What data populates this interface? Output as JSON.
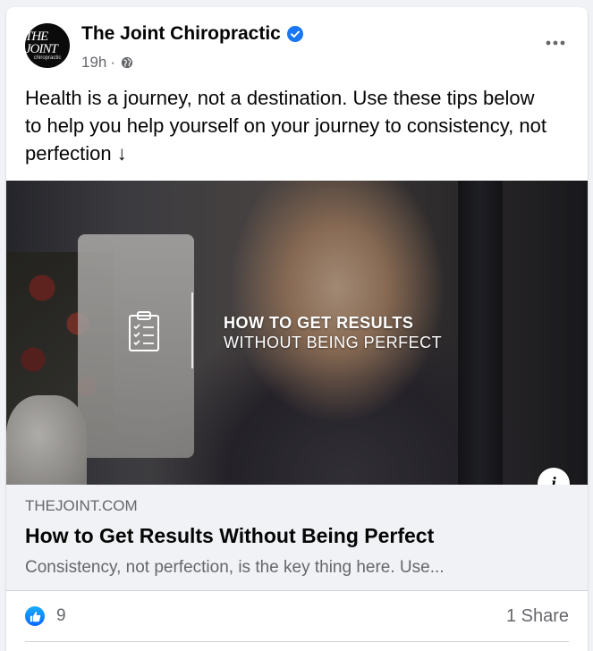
{
  "post": {
    "author": "The Joint Chiropractic",
    "verified": true,
    "time": "19h",
    "separator": "·",
    "audience_icon": "globe-icon",
    "avatar_text_main": "THE JOINT",
    "avatar_text_sub": "chiropractic",
    "text": "Health is a journey, not a destination. Use these tips below to help you help yourself on your journey to consistency, not perfection ↓"
  },
  "link": {
    "image_overlay_title": "HOW TO GET RESULTS",
    "image_overlay_subtitle": "WITHOUT BEING PERFECT",
    "info_label": "i",
    "domain": "THEJOINT.COM",
    "title": "How to Get Results Without Being Perfect",
    "description": "Consistency, not perfection, is the key thing here. Use..."
  },
  "engagement": {
    "reaction_icon": "like-icon",
    "reaction_count": "9",
    "shares": "1 Share"
  },
  "colors": {
    "verified_blue": "#1877f2",
    "like_blue": "#0866ff",
    "secondary_text": "#65676b",
    "link_footer_bg": "#f0f2f5"
  }
}
